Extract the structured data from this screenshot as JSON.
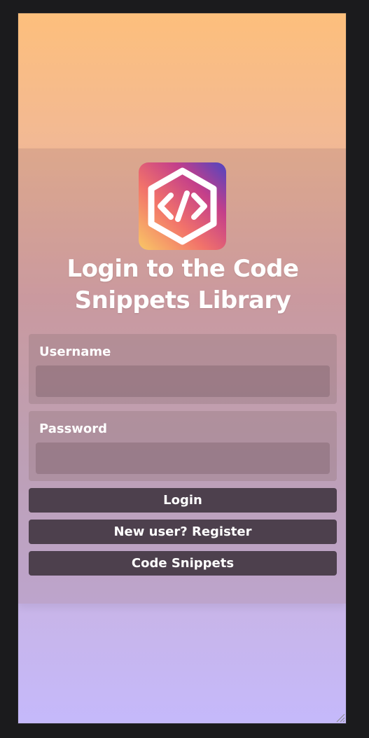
{
  "page": {
    "title": "Login to the Code Snippets Library"
  },
  "logo": {
    "icon": "code-hexagon-icon",
    "colors": [
      "#f9c866",
      "#f2736a",
      "#c43f8a",
      "#4e45c2"
    ]
  },
  "form": {
    "username": {
      "label": "Username",
      "value": "",
      "placeholder": ""
    },
    "password": {
      "label": "Password",
      "value": "",
      "placeholder": ""
    }
  },
  "buttons": {
    "login": "Login",
    "register": "New user? Register",
    "snippets": "Code Snippets"
  },
  "colors": {
    "background_top": "#fdbf7c",
    "background_bottom": "#c5b9fb",
    "button": "#4d404d",
    "text": "#ffffff"
  }
}
